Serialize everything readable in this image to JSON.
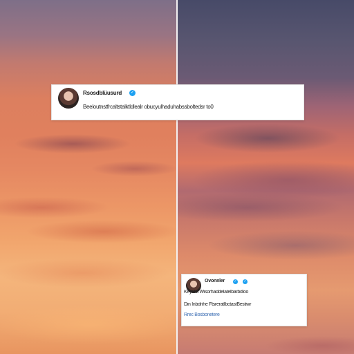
{
  "background": {
    "left_panel_description": "",
    "right_panel_description": ""
  },
  "colors": {
    "divider": "#f4f1f2",
    "card_background": "#ffffff",
    "verified_badge": "#1da1f2"
  },
  "icons": {
    "verified": "verified-badge-icon",
    "avatar": "avatar"
  },
  "card_top": {
    "name": "Rsosdblüusurd",
    "verified_glyph": "✓",
    "text": "Beeloutnstfrcaltstalktldlealr obucyulhaduhabssboltedsr to0"
  },
  "card_bottom": {
    "name": "Ovonnler",
    "verified_glyph": "✓",
    "line_1": "Keyelol  Wisorhaddelatelbarbdloo",
    "line_2": "Din  Inbdnhe FtsreratIbctastBestiwr",
    "line_3": "Rrec  Bosbonetere"
  }
}
